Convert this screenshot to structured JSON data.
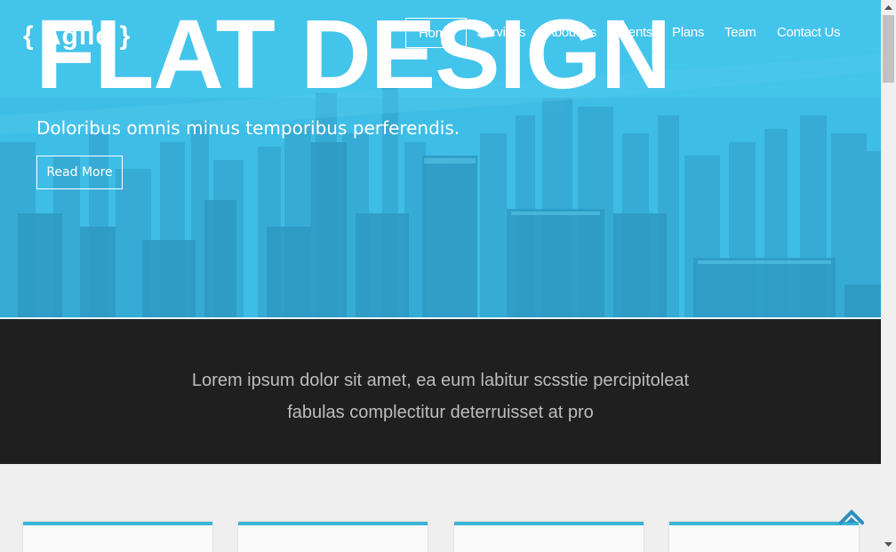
{
  "brand": {
    "logo_text": "{ Agile }"
  },
  "hero": {
    "title": "FLAT DESIGN",
    "subtitle": "Doloribus omnis minus temporibus perferendis.",
    "cta_label": "Read More"
  },
  "nav": {
    "items": [
      {
        "label": "Home",
        "active": true
      },
      {
        "label": "Services"
      },
      {
        "label": "About us"
      },
      {
        "label": "Events"
      },
      {
        "label": "Plans"
      },
      {
        "label": "Team"
      },
      {
        "label": "Contact Us"
      }
    ]
  },
  "intro": {
    "line1": "Lorem ipsum dolor sit amet, ea eum labitur scsstie percipitoleat",
    "line2": "fabulas complectitur deterruisset at pro"
  },
  "colors": {
    "hero_blue": "#41c2ea",
    "dark_band": "#1f1f1f",
    "card_accent": "#3ab3d6"
  },
  "icons": {
    "scroll_top": "chevron-up-icon"
  }
}
